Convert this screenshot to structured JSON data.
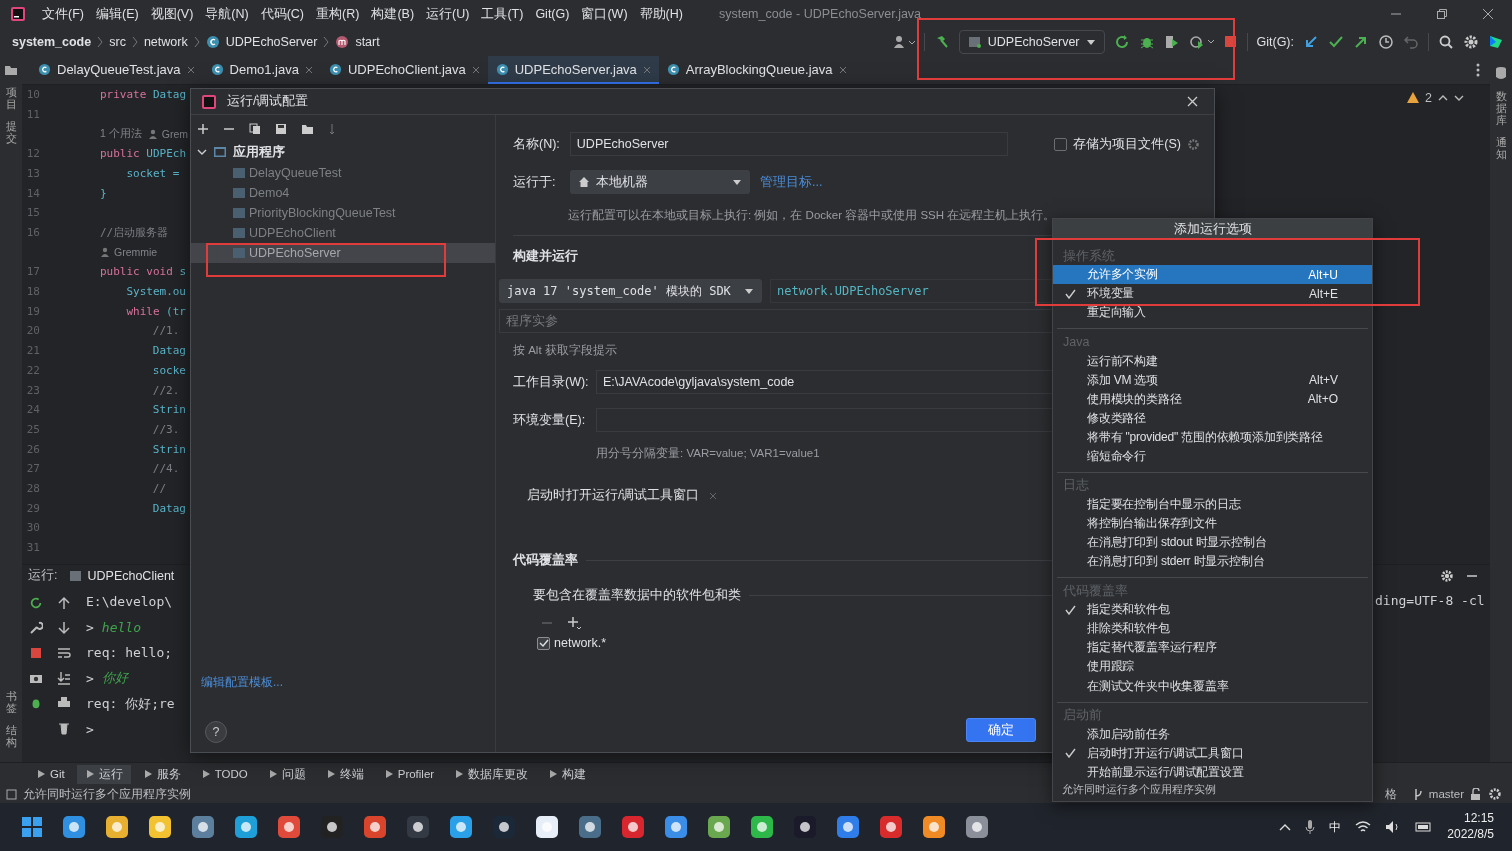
{
  "menubar": {
    "items": [
      "文件(F)",
      "编辑(E)",
      "视图(V)",
      "导航(N)",
      "代码(C)",
      "重构(R)",
      "构建(B)",
      "运行(U)",
      "工具(T)",
      "Git(G)",
      "窗口(W)",
      "帮助(H)"
    ],
    "title": "system_code - UDPEchoServer.java"
  },
  "breadcrumb": [
    {
      "label": "system_code",
      "kind": "project"
    },
    {
      "label": "src",
      "kind": "folder"
    },
    {
      "label": "network",
      "kind": "folder"
    },
    {
      "label": "UDPEchoServer",
      "kind": "class"
    },
    {
      "label": "start",
      "kind": "method"
    }
  ],
  "toolbar": {
    "run_config": "UDPEchoServer",
    "git_label": "Git(G):"
  },
  "tabs": [
    {
      "label": "DelayQueueTest.java",
      "selected": false
    },
    {
      "label": "Demo1.java",
      "selected": false
    },
    {
      "label": "UDPEchoClient.java",
      "selected": false
    },
    {
      "label": "UDPEchoServer.java",
      "selected": true
    },
    {
      "label": "ArrayBlockingQueue.java",
      "selected": false
    }
  ],
  "side_left": {
    "top": [
      "项目",
      "提交"
    ],
    "bottom": [
      "书签",
      "结构"
    ]
  },
  "side_right": [
    "数据库",
    "通知"
  ],
  "editor": {
    "warnings": "2",
    "lines": [
      {
        "kind": "code",
        "number": "10",
        "keyword": "private",
        "code": "Datag"
      },
      {
        "kind": "code",
        "number": "11"
      },
      {
        "kind": "hint",
        "usage": "1 个用法",
        "author": "Grem"
      },
      {
        "kind": "code",
        "number": "12",
        "keyword": "public",
        "code": "UDPEch"
      },
      {
        "kind": "code",
        "number": "13",
        "code": "socket ="
      },
      {
        "kind": "code",
        "number": "14",
        "code": "}"
      },
      {
        "kind": "code",
        "number": "15"
      },
      {
        "kind": "code",
        "number": "16",
        "comment": "//启动服务器"
      },
      {
        "kind": "hint",
        "author": "Gremmie"
      },
      {
        "kind": "code",
        "number": "17",
        "keyword": "public void",
        "code": "s"
      },
      {
        "kind": "code",
        "number": "18",
        "code": "System.ou"
      },
      {
        "kind": "code",
        "number": "19",
        "keyword": "while",
        "code": "(tr"
      },
      {
        "kind": "code",
        "number": "20",
        "comment": "//1."
      },
      {
        "kind": "code",
        "number": "21",
        "code": "Datag"
      },
      {
        "kind": "code",
        "number": "22",
        "code": "socke"
      },
      {
        "kind": "code",
        "number": "23",
        "comment": "//2."
      },
      {
        "kind": "code",
        "number": "24",
        "code": "Strin"
      },
      {
        "kind": "code",
        "number": "25",
        "comment": "//3."
      },
      {
        "kind": "code",
        "number": "26",
        "code": "Strin"
      },
      {
        "kind": "code",
        "number": "27",
        "comment": "//4."
      },
      {
        "kind": "code",
        "number": "28",
        "comment": "//"
      },
      {
        "kind": "code",
        "number": "29",
        "code": "Datag"
      },
      {
        "kind": "code",
        "number": "30"
      },
      {
        "kind": "code",
        "number": "31"
      }
    ]
  },
  "run_panel": {
    "label": "运行:",
    "tab": "UDPEchoClient",
    "console_tail": "ding=UTF-8 -cl",
    "console": [
      {
        "kind": "out",
        "text": "E:\\develop\\"
      },
      {
        "kind": "in",
        "prompt": ">",
        "text": "hello"
      },
      {
        "kind": "out",
        "text": "req: hello;"
      },
      {
        "kind": "in",
        "prompt": ">",
        "text": "你好"
      },
      {
        "kind": "out",
        "text": "req: 你好;re"
      },
      {
        "kind": "out",
        "text": ">"
      }
    ]
  },
  "tool_tabs": [
    {
      "label": "Git",
      "selected": false
    },
    {
      "label": "运行",
      "selected": true
    },
    {
      "label": "服务",
      "selected": false
    },
    {
      "label": "TODO",
      "selected": false
    },
    {
      "label": "问题",
      "selected": false
    },
    {
      "label": "终端",
      "selected": false
    },
    {
      "label": "Profiler",
      "selected": false
    },
    {
      "label": "数据库更改",
      "selected": false
    },
    {
      "label": "构建",
      "selected": false
    }
  ],
  "status_bar": {
    "message": "允许同时运行多个应用程序实例",
    "indent": "格",
    "branch": "master"
  },
  "taskbar": {
    "input_method": "中",
    "time": "12:15",
    "date": "2022/8/5"
  },
  "dialog": {
    "title": "运行/调试配置",
    "tree": {
      "label": "应用程序",
      "expanded": true,
      "children": [
        {
          "label": "DelayQueueTest",
          "selected": false
        },
        {
          "label": "Demo4",
          "selected": false
        },
        {
          "label": "PriorityBlockingQueueTest",
          "selected": false
        },
        {
          "label": "UDPEchoClient",
          "selected": false
        },
        {
          "label": "UDPEchoServer",
          "selected": true
        }
      ]
    },
    "template_link": "编辑配置模板...",
    "help": "?",
    "name_label": "名称(N):",
    "name_value": "UDPEchoServer",
    "store_label": "存储为项目文件(S)",
    "store_checked": false,
    "run_on_label": "运行于:",
    "run_on_value": "本地机器",
    "manage_link": "管理目标...",
    "run_on_hint": "运行配置可以在本地或目标上执行: 例如，在 Docker 容器中或使用 SSH 在远程主机上执行。",
    "build_section": "构建并运行",
    "sdk": "java 17 'system_code' 模块的 SDK",
    "main_class": "network.UDPEchoServer",
    "args_field": {
      "placeholder": "程序实参"
    },
    "alt_hint": "按 Alt 获取字段提示",
    "workdir_label": "工作目录(W):",
    "workdir_value": "E:\\JAVAcode\\gyljava\\system_code",
    "env_label": "环境变量(E):",
    "env_hint": "用分号分隔变量: VAR=value; VAR1=value1",
    "option_tag": "启动时打开运行/调试工具窗口",
    "coverage_section": "代码覆盖率",
    "coverage_sub": "要包含在覆盖率数据中的软件包和类",
    "coverage_patterns": [
      {
        "label": "network.*",
        "checked": true
      }
    ],
    "ok": "确定"
  },
  "menu": {
    "title": "添加运行选项",
    "footer": "允许同时运行多个应用程序实例",
    "sections": [
      {
        "header": "操作系统",
        "items": [
          {
            "label": "允许多个实例",
            "shortcut": "Alt+U",
            "checked": false,
            "selected": true
          },
          {
            "label": "环境变量",
            "shortcut": "Alt+E",
            "checked": true,
            "selected": false
          },
          {
            "label": "重定向输入",
            "checked": false,
            "selected": false
          }
        ]
      },
      {
        "header": "Java",
        "items": [
          {
            "label": "运行前不构建",
            "checked": false,
            "selected": false
          },
          {
            "label": "添加 VM 选项",
            "shortcut": "Alt+V",
            "checked": false,
            "selected": false
          },
          {
            "label": "使用模块的类路径",
            "shortcut": "Alt+O",
            "checked": false,
            "selected": false
          },
          {
            "label": "修改类路径",
            "checked": false,
            "selected": false
          },
          {
            "label": "将带有 \"provided\" 范围的依赖项添加到类路径",
            "checked": false,
            "selected": false
          },
          {
            "label": "缩短命令行",
            "checked": false,
            "selected": false
          }
        ]
      },
      {
        "header": "日志",
        "items": [
          {
            "label": "指定要在控制台中显示的日志",
            "checked": false,
            "selected": false
          },
          {
            "label": "将控制台输出保存到文件",
            "checked": false,
            "selected": false
          },
          {
            "label": "在消息打印到 stdout 时显示控制台",
            "checked": false,
            "selected": false
          },
          {
            "label": "在消息打印到 stderr 时显示控制台",
            "checked": false,
            "selected": false
          }
        ]
      },
      {
        "header": "代码覆盖率",
        "items": [
          {
            "label": "指定类和软件包",
            "checked": true,
            "selected": false
          },
          {
            "label": "排除类和软件包",
            "checked": false,
            "selected": false
          },
          {
            "label": "指定替代覆盖率运行程序",
            "checked": false,
            "selected": false
          },
          {
            "label": "使用跟踪",
            "checked": false,
            "selected": false
          },
          {
            "label": "在测试文件夹中收集覆盖率",
            "checked": false,
            "selected": false
          }
        ]
      },
      {
        "header": "启动前",
        "items": [
          {
            "label": "添加启动前任务",
            "checked": false,
            "selected": false
          },
          {
            "label": "启动时打开运行/调试工具窗口",
            "checked": true,
            "selected": false
          },
          {
            "label": "开始前显示运行/调试配置设置",
            "checked": false,
            "selected": false
          }
        ]
      }
    ]
  }
}
